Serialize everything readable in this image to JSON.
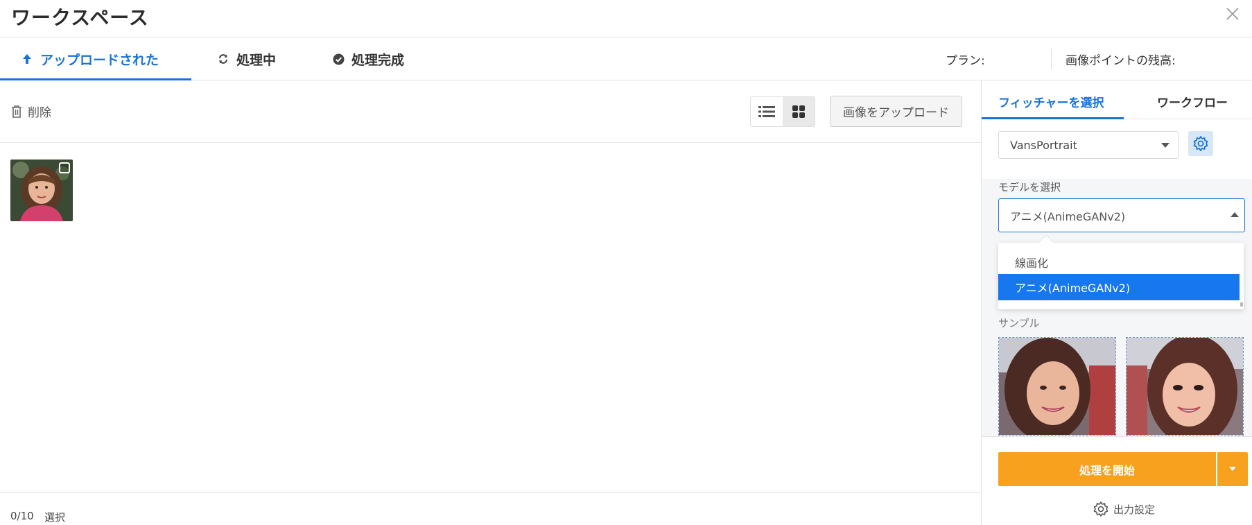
{
  "header": {
    "title": "ワークスペース"
  },
  "tabs": [
    {
      "label": "アップロードされた",
      "icon": "upload-arrow-icon",
      "active": true
    },
    {
      "label": "処理中",
      "icon": "refresh-icon",
      "active": false
    },
    {
      "label": "処理完成",
      "icon": "check-circle-icon",
      "active": false
    }
  ],
  "account": {
    "plan_label": "プラン:",
    "points_label": "画像ポイントの残高:"
  },
  "toolbar": {
    "delete_label": "削除",
    "upload_label": "画像をアップロード",
    "view_mode": "grid"
  },
  "footer": {
    "selected_count": "0/10",
    "select_label": "選択"
  },
  "right_panel": {
    "tabs": [
      {
        "label": "フィッチャーを選択",
        "active": true
      },
      {
        "label": "ワークフロー",
        "active": false
      }
    ],
    "feature_select": {
      "value": "VansPortrait"
    },
    "model_label": "モデルを選択",
    "model_select": {
      "value": "アニメ(AnimeGANv2)"
    },
    "model_options": [
      {
        "label": "線画化",
        "selected": false
      },
      {
        "label": "アニメ(AnimeGANv2)",
        "selected": true
      }
    ],
    "sample_label": "サンプル",
    "start_label": "処理を開始",
    "output_settings_label": "出力設定"
  },
  "colors": {
    "accent": "#1a73d9",
    "selected_option": "#1677ee",
    "start_button": "#f7a11f"
  }
}
